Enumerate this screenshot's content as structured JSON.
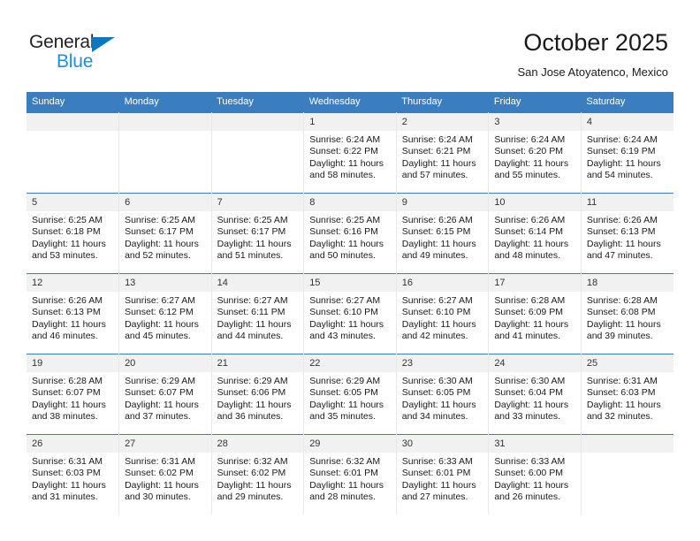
{
  "brand": {
    "name_part1": "General",
    "name_part2": "Blue",
    "accent_color": "#1f8fd6",
    "triangle_color": "#0f76bc"
  },
  "header": {
    "title": "October 2025",
    "location": "San Jose Atoyatenco, Mexico",
    "header_bg": "#3b7ebf"
  },
  "weekday_headers": [
    "Sunday",
    "Monday",
    "Tuesday",
    "Wednesday",
    "Thursday",
    "Friday",
    "Saturday"
  ],
  "weeks": [
    [
      {
        "day": "",
        "blank": true
      },
      {
        "day": "",
        "blank": true
      },
      {
        "day": "",
        "blank": true
      },
      {
        "day": "1",
        "sunrise": "Sunrise: 6:24 AM",
        "sunset": "Sunset: 6:22 PM",
        "daylight": "Daylight: 11 hours and 58 minutes."
      },
      {
        "day": "2",
        "sunrise": "Sunrise: 6:24 AM",
        "sunset": "Sunset: 6:21 PM",
        "daylight": "Daylight: 11 hours and 57 minutes."
      },
      {
        "day": "3",
        "sunrise": "Sunrise: 6:24 AM",
        "sunset": "Sunset: 6:20 PM",
        "daylight": "Daylight: 11 hours and 55 minutes."
      },
      {
        "day": "4",
        "sunrise": "Sunrise: 6:24 AM",
        "sunset": "Sunset: 6:19 PM",
        "daylight": "Daylight: 11 hours and 54 minutes."
      }
    ],
    [
      {
        "day": "5",
        "sunrise": "Sunrise: 6:25 AM",
        "sunset": "Sunset: 6:18 PM",
        "daylight": "Daylight: 11 hours and 53 minutes."
      },
      {
        "day": "6",
        "sunrise": "Sunrise: 6:25 AM",
        "sunset": "Sunset: 6:17 PM",
        "daylight": "Daylight: 11 hours and 52 minutes."
      },
      {
        "day": "7",
        "sunrise": "Sunrise: 6:25 AM",
        "sunset": "Sunset: 6:17 PM",
        "daylight": "Daylight: 11 hours and 51 minutes."
      },
      {
        "day": "8",
        "sunrise": "Sunrise: 6:25 AM",
        "sunset": "Sunset: 6:16 PM",
        "daylight": "Daylight: 11 hours and 50 minutes."
      },
      {
        "day": "9",
        "sunrise": "Sunrise: 6:26 AM",
        "sunset": "Sunset: 6:15 PM",
        "daylight": "Daylight: 11 hours and 49 minutes."
      },
      {
        "day": "10",
        "sunrise": "Sunrise: 6:26 AM",
        "sunset": "Sunset: 6:14 PM",
        "daylight": "Daylight: 11 hours and 48 minutes."
      },
      {
        "day": "11",
        "sunrise": "Sunrise: 6:26 AM",
        "sunset": "Sunset: 6:13 PM",
        "daylight": "Daylight: 11 hours and 47 minutes."
      }
    ],
    [
      {
        "day": "12",
        "sunrise": "Sunrise: 6:26 AM",
        "sunset": "Sunset: 6:13 PM",
        "daylight": "Daylight: 11 hours and 46 minutes."
      },
      {
        "day": "13",
        "sunrise": "Sunrise: 6:27 AM",
        "sunset": "Sunset: 6:12 PM",
        "daylight": "Daylight: 11 hours and 45 minutes."
      },
      {
        "day": "14",
        "sunrise": "Sunrise: 6:27 AM",
        "sunset": "Sunset: 6:11 PM",
        "daylight": "Daylight: 11 hours and 44 minutes."
      },
      {
        "day": "15",
        "sunrise": "Sunrise: 6:27 AM",
        "sunset": "Sunset: 6:10 PM",
        "daylight": "Daylight: 11 hours and 43 minutes."
      },
      {
        "day": "16",
        "sunrise": "Sunrise: 6:27 AM",
        "sunset": "Sunset: 6:10 PM",
        "daylight": "Daylight: 11 hours and 42 minutes."
      },
      {
        "day": "17",
        "sunrise": "Sunrise: 6:28 AM",
        "sunset": "Sunset: 6:09 PM",
        "daylight": "Daylight: 11 hours and 41 minutes."
      },
      {
        "day": "18",
        "sunrise": "Sunrise: 6:28 AM",
        "sunset": "Sunset: 6:08 PM",
        "daylight": "Daylight: 11 hours and 39 minutes."
      }
    ],
    [
      {
        "day": "19",
        "sunrise": "Sunrise: 6:28 AM",
        "sunset": "Sunset: 6:07 PM",
        "daylight": "Daylight: 11 hours and 38 minutes."
      },
      {
        "day": "20",
        "sunrise": "Sunrise: 6:29 AM",
        "sunset": "Sunset: 6:07 PM",
        "daylight": "Daylight: 11 hours and 37 minutes."
      },
      {
        "day": "21",
        "sunrise": "Sunrise: 6:29 AM",
        "sunset": "Sunset: 6:06 PM",
        "daylight": "Daylight: 11 hours and 36 minutes."
      },
      {
        "day": "22",
        "sunrise": "Sunrise: 6:29 AM",
        "sunset": "Sunset: 6:05 PM",
        "daylight": "Daylight: 11 hours and 35 minutes."
      },
      {
        "day": "23",
        "sunrise": "Sunrise: 6:30 AM",
        "sunset": "Sunset: 6:05 PM",
        "daylight": "Daylight: 11 hours and 34 minutes."
      },
      {
        "day": "24",
        "sunrise": "Sunrise: 6:30 AM",
        "sunset": "Sunset: 6:04 PM",
        "daylight": "Daylight: 11 hours and 33 minutes."
      },
      {
        "day": "25",
        "sunrise": "Sunrise: 6:31 AM",
        "sunset": "Sunset: 6:03 PM",
        "daylight": "Daylight: 11 hours and 32 minutes."
      }
    ],
    [
      {
        "day": "26",
        "sunrise": "Sunrise: 6:31 AM",
        "sunset": "Sunset: 6:03 PM",
        "daylight": "Daylight: 11 hours and 31 minutes."
      },
      {
        "day": "27",
        "sunrise": "Sunrise: 6:31 AM",
        "sunset": "Sunset: 6:02 PM",
        "daylight": "Daylight: 11 hours and 30 minutes."
      },
      {
        "day": "28",
        "sunrise": "Sunrise: 6:32 AM",
        "sunset": "Sunset: 6:02 PM",
        "daylight": "Daylight: 11 hours and 29 minutes."
      },
      {
        "day": "29",
        "sunrise": "Sunrise: 6:32 AM",
        "sunset": "Sunset: 6:01 PM",
        "daylight": "Daylight: 11 hours and 28 minutes."
      },
      {
        "day": "30",
        "sunrise": "Sunrise: 6:33 AM",
        "sunset": "Sunset: 6:01 PM",
        "daylight": "Daylight: 11 hours and 27 minutes."
      },
      {
        "day": "31",
        "sunrise": "Sunrise: 6:33 AM",
        "sunset": "Sunset: 6:00 PM",
        "daylight": "Daylight: 11 hours and 26 minutes."
      },
      {
        "day": "",
        "blank": true
      }
    ]
  ]
}
